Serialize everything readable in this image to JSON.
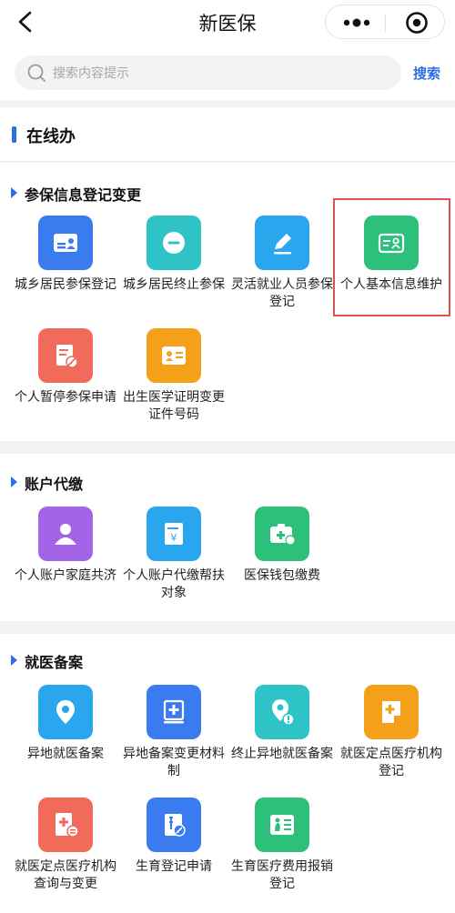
{
  "header": {
    "title": "新医保"
  },
  "search": {
    "placeholder": "搜索内容提示",
    "button": "搜索"
  },
  "section": {
    "title": "在线办"
  },
  "categories": [
    {
      "title": "参保信息登记变更",
      "items": [
        {
          "label": "城乡居民参保登记",
          "icon": "id-card-icon",
          "color": "#3a7cf0"
        },
        {
          "label": "城乡居民终止参保",
          "icon": "minus-circle-icon",
          "color": "#2ec3c6"
        },
        {
          "label": "灵活就业人员参保登记",
          "icon": "edit-pen-icon",
          "color": "#2aa6ee"
        },
        {
          "label": "个人基本信息维护",
          "icon": "profile-card-icon",
          "color": "#2cc07a"
        },
        {
          "label": "个人暂停参保申请",
          "icon": "document-stop-icon",
          "color": "#f26a5a"
        },
        {
          "label": "出生医学证明变更证件号码",
          "icon": "baby-certificate-icon",
          "color": "#f5a019"
        }
      ]
    },
    {
      "title": "账户代缴",
      "items": [
        {
          "label": "个人账户家庭共济",
          "icon": "people-icon",
          "color": "#a364e8"
        },
        {
          "label": "个人账户代缴帮扶对象",
          "icon": "yen-document-icon",
          "color": "#2aa6ee"
        },
        {
          "label": "医保钱包缴费",
          "icon": "medical-wallet-icon",
          "color": "#2cc07a"
        }
      ]
    },
    {
      "title": "就医备案",
      "items": [
        {
          "label": "异地就医备案",
          "icon": "location-pin-icon",
          "color": "#2aa6ee"
        },
        {
          "label": "异地备案变更材料制",
          "icon": "medical-clipboard-icon",
          "color": "#3a7cf0"
        },
        {
          "label": "终止异地就医备案",
          "icon": "location-warning-icon",
          "color": "#2ec3c6"
        },
        {
          "label": "就医定点医疗机构登记",
          "icon": "medical-building-icon",
          "color": "#f5a019"
        },
        {
          "label": "就医定点医疗机构查询与变更",
          "icon": "medical-change-icon",
          "color": "#f26a5a"
        },
        {
          "label": "生育登记申请",
          "icon": "birth-register-icon",
          "color": "#3a7cf0"
        },
        {
          "label": "生育医疗费用报销登记",
          "icon": "maternity-reimburse-icon",
          "color": "#2cc07a"
        }
      ]
    }
  ]
}
